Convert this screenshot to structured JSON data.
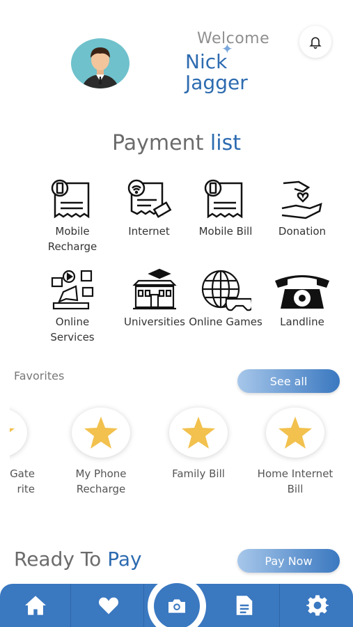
{
  "header": {
    "welcome": "Welcome",
    "name": "Nick Jagger",
    "avatar_icon": "user-avatar-icon",
    "bell_icon": "bell-icon"
  },
  "payment": {
    "title_part1": "Payment",
    "title_part2": "list",
    "items": [
      {
        "label": "Mobile Recharge",
        "icon": "mobile-recharge-icon"
      },
      {
        "label": "Internet",
        "icon": "internet-bill-icon"
      },
      {
        "label": "Mobile Bill",
        "icon": "mobile-bill-icon"
      },
      {
        "label": "Donation",
        "icon": "donation-icon"
      },
      {
        "label": "Online Services",
        "icon": "online-services-icon"
      },
      {
        "label": "Universities",
        "icon": "university-icon"
      },
      {
        "label": "Online Games",
        "icon": "online-games-icon"
      },
      {
        "label": "Landline",
        "icon": "landline-phone-icon"
      }
    ]
  },
  "favorites": {
    "title": "Favorites",
    "see_all": "See all",
    "items": [
      {
        "label": "Gate\nrite",
        "icon": "star-icon"
      },
      {
        "label": "My Phone Recharge",
        "icon": "star-icon"
      },
      {
        "label": "Family Bill",
        "icon": "star-icon"
      },
      {
        "label": "Home Internet Bill",
        "icon": "star-icon"
      }
    ]
  },
  "ready": {
    "part1": "Ready To",
    "part2": "Pay",
    "button": "Pay Now"
  },
  "nav": {
    "items": [
      "home-icon",
      "heart-icon",
      "camera-icon",
      "document-icon",
      "settings-icon"
    ]
  },
  "colors": {
    "accent": "#3a78c0",
    "title_gray": "#6b6b6b",
    "star": "#f2c14e"
  }
}
